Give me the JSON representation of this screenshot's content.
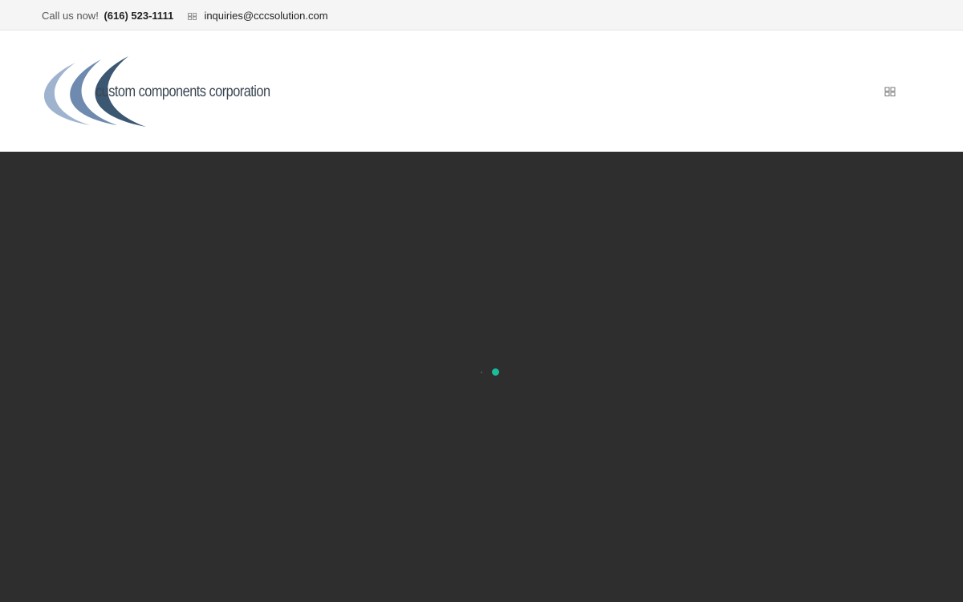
{
  "topbar": {
    "call_label": "Call us now!",
    "phone": "(616) 523-1111",
    "email_icon": "envelope-icon",
    "email": "inquiries@cccsolution.com"
  },
  "header": {
    "logo_text": "custom components corporation",
    "menu_icon": "grid-menu-icon"
  },
  "hero": {
    "loader": "loading-spinner"
  },
  "colors": {
    "topbar_bg": "#f5f5f5",
    "hero_bg": "#2e2e2e",
    "loader_accent": "#1abc9c",
    "logo_swoosh_light": "#9fb3cf",
    "logo_swoosh_mid": "#6e8aae",
    "logo_swoosh_dark": "#3b5772"
  }
}
